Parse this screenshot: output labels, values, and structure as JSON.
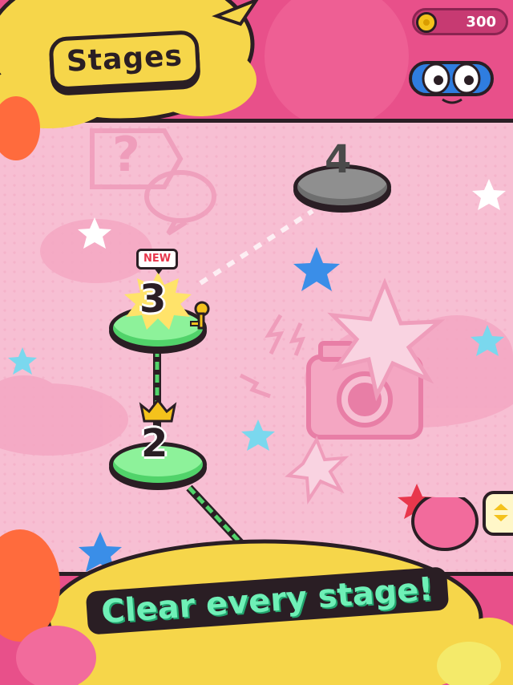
{
  "header": {
    "title": "Stages",
    "coins": "300",
    "coin_icon": "coin-icon",
    "mascot": "mask-mascot"
  },
  "stages": [
    {
      "number": "2",
      "state": "completed",
      "crown": true
    },
    {
      "number": "3",
      "state": "available",
      "badge": "NEW",
      "key": true
    },
    {
      "number": "4",
      "state": "locked"
    }
  ],
  "banner": {
    "text": "Clear every stage!"
  },
  "colors": {
    "background": "#e8508a",
    "map_panel": "#f7bfd3",
    "stage_green": "#8df29a",
    "stage_locked": "#8f8f8f",
    "title_yellow": "#f6d64a",
    "banner_text": "#6ff0b7"
  }
}
